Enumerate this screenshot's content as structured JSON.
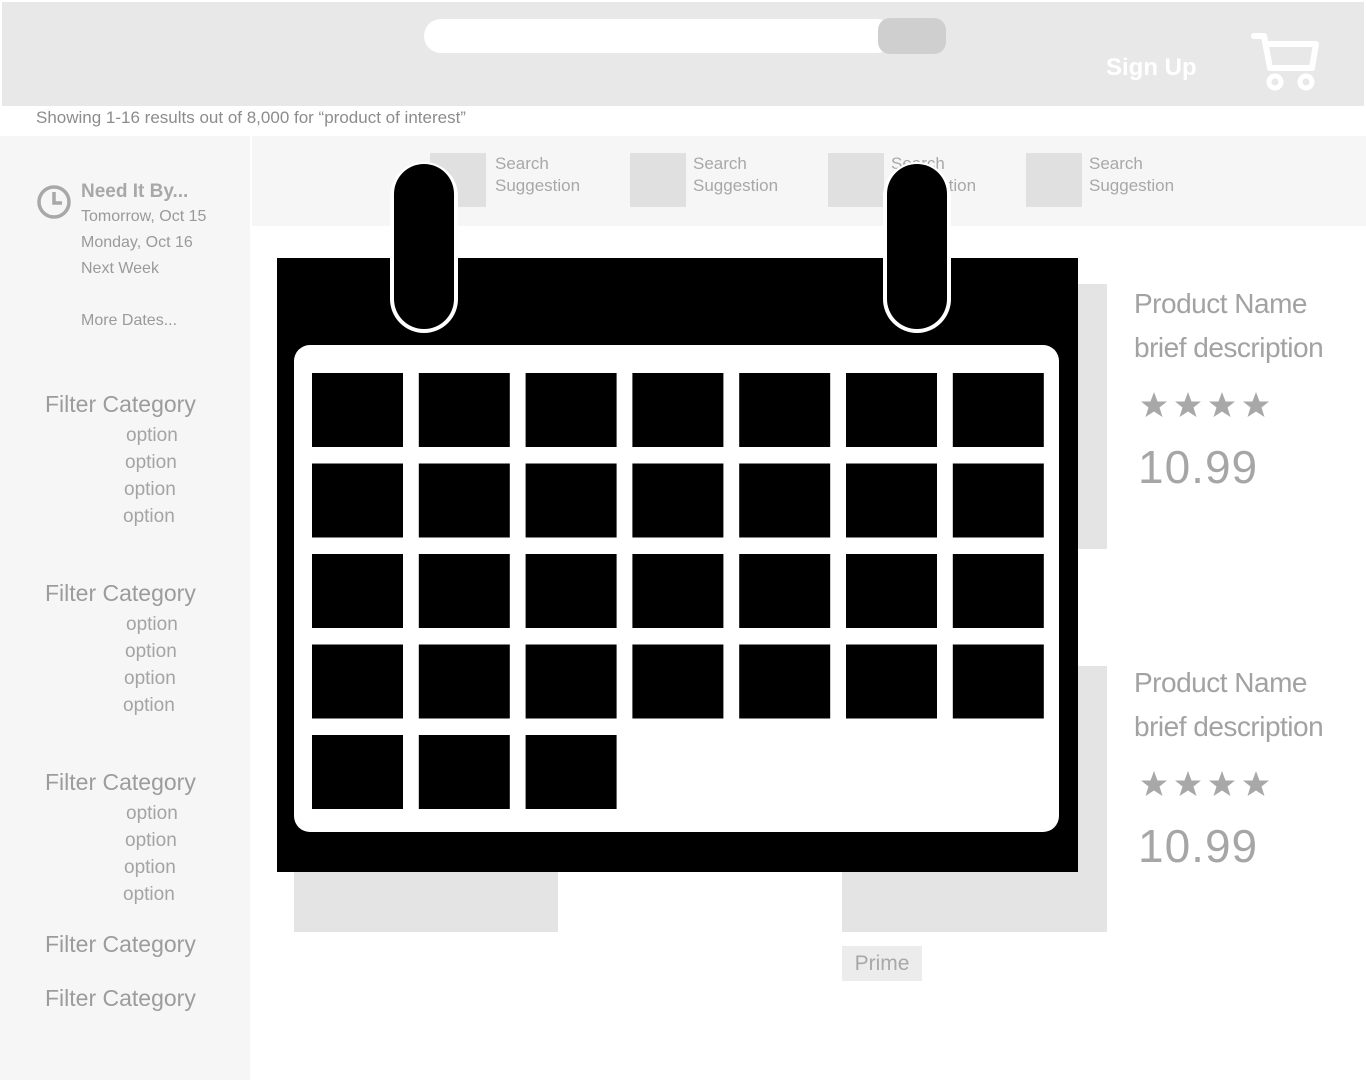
{
  "header": {
    "search_placeholder": "",
    "signup_label": "Sign Up"
  },
  "results": {
    "summary": "Showing 1-16 results out of 8,000 for “product of interest”"
  },
  "sidebar": {
    "need_it_by": {
      "title": "Need It By...",
      "options": [
        "Tomorrow, Oct 15",
        "Monday, Oct 16",
        "Next Week"
      ],
      "more": "More Dates..."
    },
    "filters": [
      {
        "label": "Filter Category",
        "options": [
          "option",
          "option",
          "option",
          "option"
        ]
      },
      {
        "label": "Filter Category",
        "options": [
          "option",
          "option",
          "option",
          "option"
        ]
      },
      {
        "label": "Filter Category",
        "options": [
          "option",
          "option",
          "option",
          "option"
        ]
      },
      {
        "label": "Filter Category",
        "options": []
      },
      {
        "label": "Filter Category",
        "options": []
      }
    ]
  },
  "suggestions": [
    "Search\nSuggestion",
    "Search\nSuggestion",
    "Search\nSuggestion",
    "Search\nSuggestion"
  ],
  "products": [
    {
      "name": "Product Name",
      "description": "brief description",
      "rating": 4,
      "price": "10.99"
    },
    {
      "name": "Product Name",
      "description": "brief description",
      "rating": 4,
      "price": "10.99",
      "badge": "Prime"
    }
  ],
  "calendar_overlay": {
    "icon": "calendar-icon",
    "rows": 5,
    "columns": 7,
    "day_count": 31
  },
  "colors": {
    "header_bg": "#e8e8e8",
    "sidebar_bg": "#f6f6f6",
    "placeholder_grey": "#e4e4e4",
    "calendar": "#000000"
  }
}
